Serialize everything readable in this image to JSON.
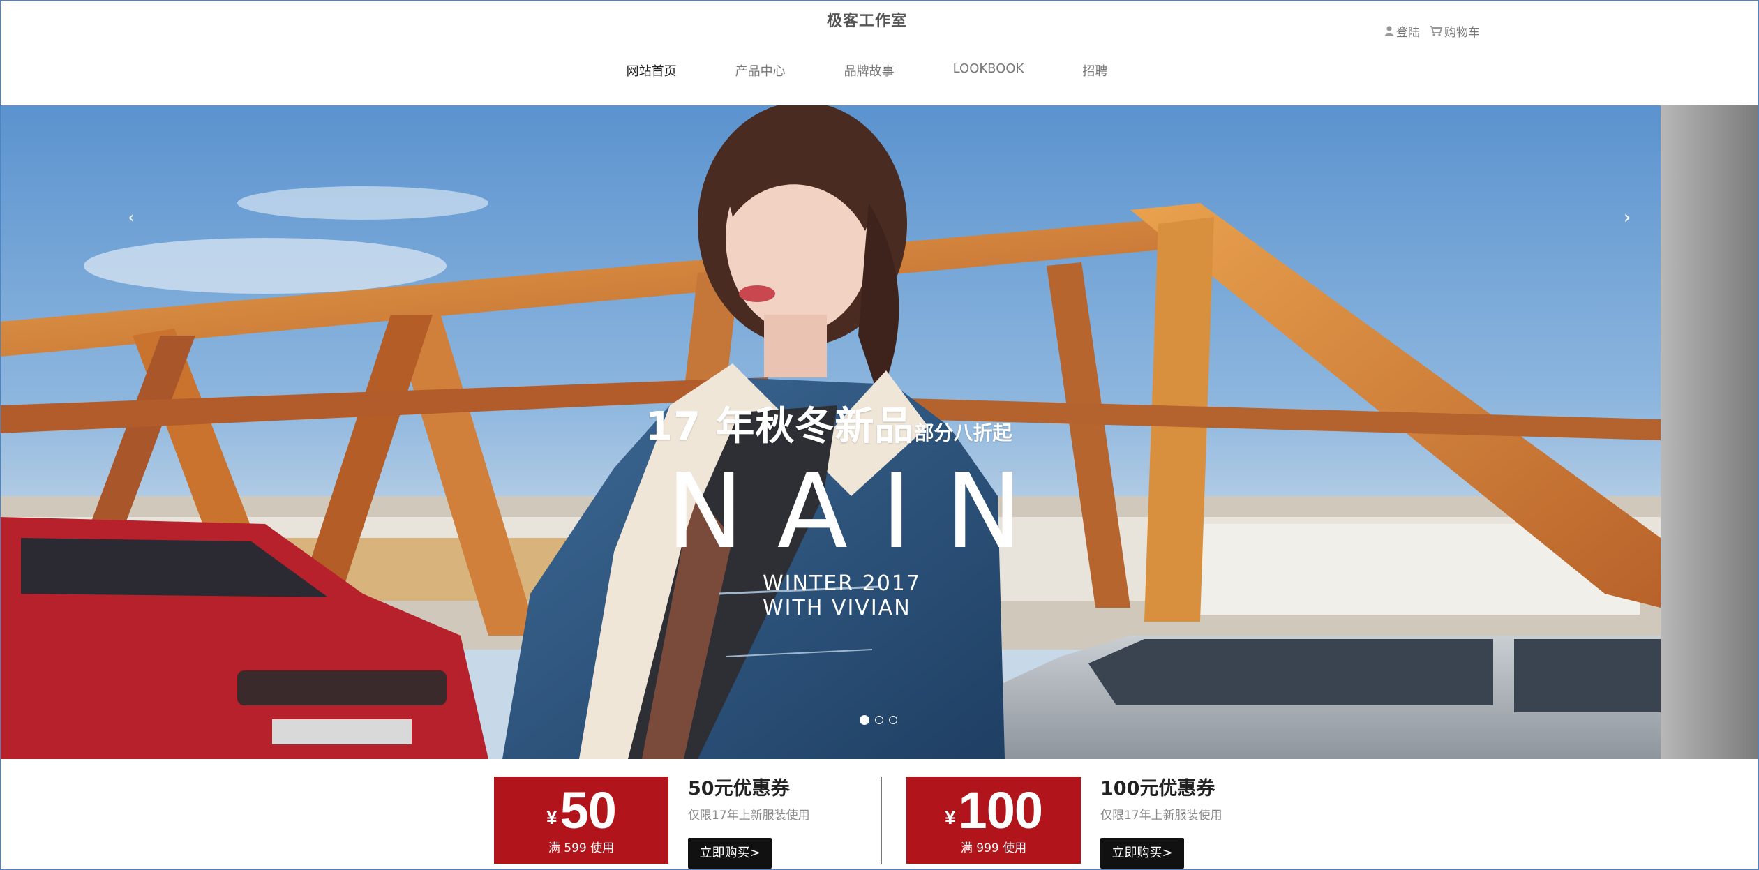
{
  "header": {
    "brand": "极客工作室",
    "login_label": "登陆",
    "cart_label": "购物车"
  },
  "nav": [
    {
      "label": "网站首页",
      "active": true
    },
    {
      "label": "产品中心",
      "active": false
    },
    {
      "label": "品牌故事",
      "active": false
    },
    {
      "label": "LOOKBOOK",
      "active": false
    },
    {
      "label": "招聘",
      "active": false
    }
  ],
  "hero": {
    "prev_arrow": "‹",
    "next_arrow": "›",
    "headline_big": "17 年秋冬新品",
    "headline_small": "部分八折起",
    "logo_word": "NAIN",
    "season_line1": "WINTER 2017",
    "season_line2": "WITH VIVIAN",
    "slides_total": 3,
    "active_slide": 1
  },
  "coupons": [
    {
      "currency": "¥",
      "amount": "50",
      "condition": "满 599 使用",
      "title": "50元优惠券",
      "desc": "仅限17年上新服装使用",
      "button": "立即购买>"
    },
    {
      "currency": "¥",
      "amount": "100",
      "condition": "满 999 使用",
      "title": "100元优惠券",
      "desc": "仅限17年上新服装使用",
      "button": "立即购买>"
    }
  ],
  "colors": {
    "coupon_red": "#b1141a",
    "button_black": "#111111",
    "sky_blue": "#6f9fcf",
    "bridge_orange": "#d98a3a"
  }
}
